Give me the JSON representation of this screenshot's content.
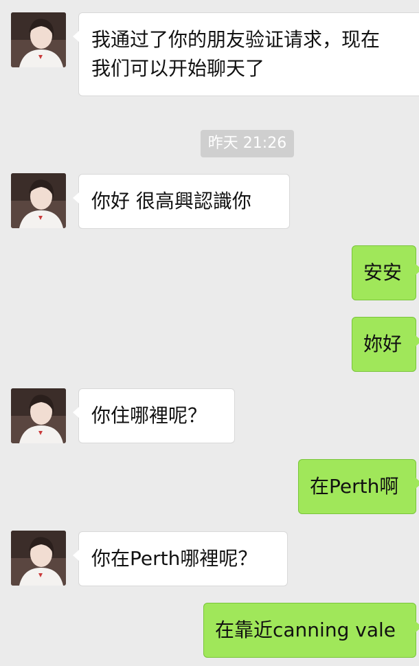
{
  "chat": {
    "timestamp": "昨天 21:26",
    "messages": [
      {
        "side": "left",
        "lines": [
          "我通过了你的朋友验证请求，现在",
          "我们可以开始聊天了"
        ]
      },
      {
        "side": "left",
        "text": "你好  很高興認識你"
      },
      {
        "side": "right",
        "text": "安安"
      },
      {
        "side": "right",
        "text": "妳好"
      },
      {
        "side": "left",
        "text": "你住哪裡呢？"
      },
      {
        "side": "right",
        "text": "在Perth啊"
      },
      {
        "side": "left",
        "text": "你在Perth哪裡呢？"
      },
      {
        "side": "right",
        "text": "在靠近canning vale"
      }
    ]
  },
  "colors": {
    "background": "#ebebeb",
    "incoming_bubble": "#ffffff",
    "outgoing_bubble": "#a0e75a",
    "timestamp_badge": "#cfcfcf"
  },
  "icons": {
    "contact_avatar": "avatar"
  }
}
